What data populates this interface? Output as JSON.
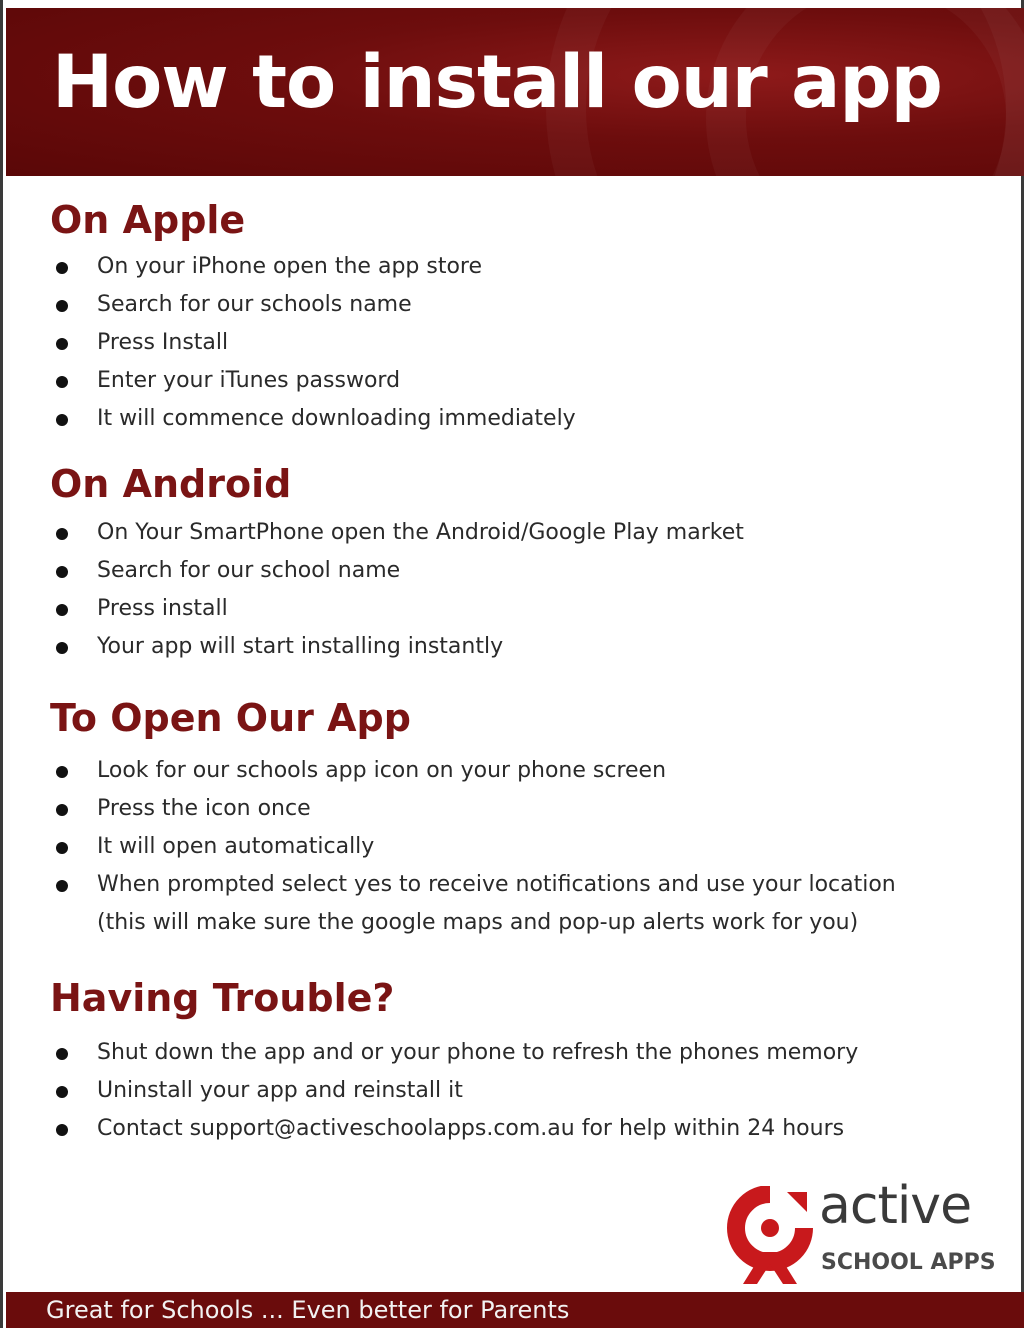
{
  "header": {
    "title": "How to install our app"
  },
  "sections": [
    {
      "title": "On Apple",
      "items": [
        "On your iPhone open the app store",
        "Search for our schools name",
        "Press Install",
        "Enter your iTunes password",
        "It will commence downloading immediately"
      ]
    },
    {
      "title": "On Android",
      "items": [
        "On Your SmartPhone open the Android/Google Play market",
        "Search for our school name",
        "Press install",
        "Your app will start installing instantly"
      ]
    },
    {
      "title": "To Open Our App",
      "items": [
        "Look for our schools app icon on your phone screen",
        "Press the icon once",
        "It will open automatically",
        "When prompted select yes to receive notifications and use your location (this will make sure the google maps and pop-up alerts work for you)"
      ]
    },
    {
      "title": "Having Trouble?",
      "items": [
        "Shut down the app and or your phone to refresh the phones memory",
        "Uninstall your app and reinstall it",
        "Contact support@activeschoolapps.com.au for help within 24 hours"
      ]
    }
  ],
  "logo": {
    "word": "active",
    "sub": "SCHOOL APPS"
  },
  "footer": {
    "tagline": "Great for Schools ... Even better for Parents"
  },
  "colors": {
    "brand": "#6d0d0d",
    "heading": "#7a1414",
    "logo_red": "#c8191c"
  }
}
